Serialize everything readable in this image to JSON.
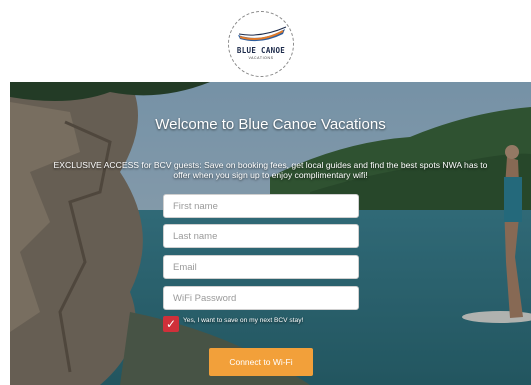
{
  "logo": {
    "title": "BLUE CANOE",
    "subtitle": "VACATIONS",
    "icon": "canoe-icon"
  },
  "hero": {
    "welcome": "Welcome to Blue Canoe Vacations",
    "blurb": "EXCLUSIVE ACCESS for BCV guests: Save on booking fees, get local guides and find the best spots NWA has to offer when you sign up to enjoy complimentary wifi!"
  },
  "form": {
    "first_name_placeholder": "First name",
    "last_name_placeholder": "Last name",
    "email_placeholder": "Email",
    "password_placeholder": "WiFi Password",
    "consent_label": "Yes, I want to save on my next BCV stay!",
    "consent_checked": true,
    "submit_label": "Connect to Wi-Fi"
  },
  "colors": {
    "accent": "#f2a03a",
    "checkbox": "#d0303a",
    "brand_navy": "#1c2a4a"
  }
}
